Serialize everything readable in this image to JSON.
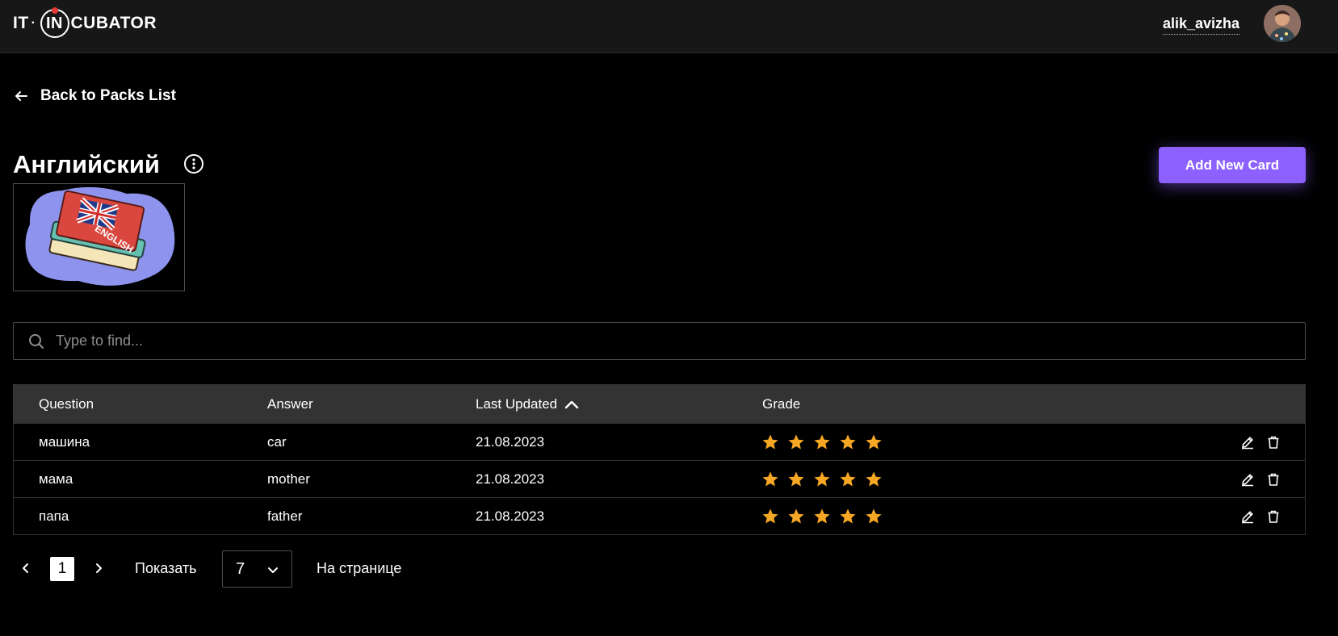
{
  "header": {
    "logo": {
      "left": "IT",
      "ring": "IN",
      "right": "CUBATOR"
    },
    "username": "alik_avizha"
  },
  "back_link": "Back to Packs List",
  "pack": {
    "title": "Английский",
    "image_text": "ENGLISH"
  },
  "add_button": "Add New Card",
  "search": {
    "placeholder": "Type to find...",
    "value": ""
  },
  "table": {
    "columns": [
      "Question",
      "Answer",
      "Last Updated",
      "Grade"
    ],
    "sort_column": "Last Updated",
    "sort_direction": "ascending",
    "rows": [
      {
        "question": "машина",
        "answer": "car",
        "updated": "21.08.2023",
        "grade": 5
      },
      {
        "question": "мама",
        "answer": "mother",
        "updated": "21.08.2023",
        "grade": 5
      },
      {
        "question": "папа",
        "answer": "father",
        "updated": "21.08.2023",
        "grade": 5
      }
    ]
  },
  "pagination": {
    "current_page": "1",
    "show_label": "Показать",
    "page_size": "7",
    "per_page_label": "На странице"
  },
  "colors": {
    "accent": "#8c61ff",
    "star": "#f6a723",
    "header_bg": "#171717",
    "table_head_bg": "#333333"
  }
}
